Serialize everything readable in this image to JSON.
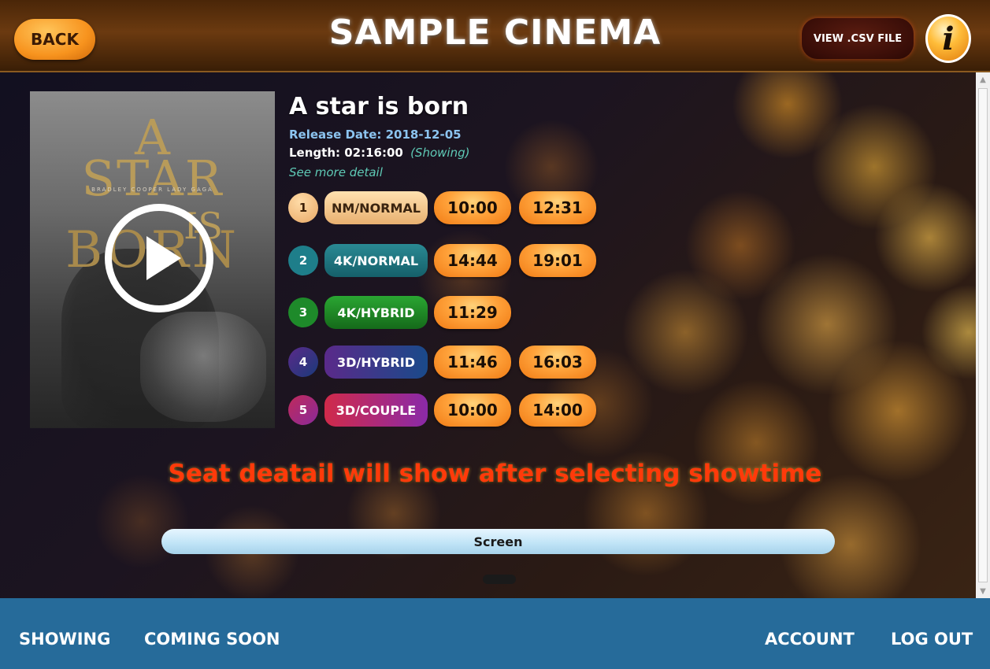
{
  "header": {
    "back_label": "BACK",
    "title": "SAMPLE CINEMA",
    "csv_label": "VIEW .CSV FILE",
    "info_glyph": "i"
  },
  "poster": {
    "text_a": "A",
    "text_star": "STAR",
    "text_is": "IS",
    "text_born": "BORN",
    "text_names": "BRADLEY COOPER   LADY GAGA"
  },
  "movie": {
    "title": "A star is born",
    "release": "Release Date: 2018-12-05",
    "length": "Length: 02:16:00",
    "status": "(Showing)",
    "more_detail": "See more detail"
  },
  "showtimes": [
    {
      "num": "1",
      "type": "NM/NORMAL",
      "times": [
        "10:00",
        "12:31"
      ]
    },
    {
      "num": "2",
      "type": "4K/NORMAL",
      "times": [
        "14:44",
        "19:01"
      ]
    },
    {
      "num": "3",
      "type": "4K/HYBRID",
      "times": [
        "11:29"
      ]
    },
    {
      "num": "4",
      "type": "3D/HYBRID",
      "times": [
        "11:46",
        "16:03"
      ]
    },
    {
      "num": "5",
      "type": "3D/COUPLE",
      "times": [
        "10:00",
        "14:00"
      ]
    }
  ],
  "seat_message": "Seat deatail will show after selecting showtime",
  "screen_label": "Screen",
  "footer": {
    "showing": "SHOWING",
    "coming_soon": "COMING SOON",
    "account": "ACCOUNT",
    "logout": "LOG OUT"
  },
  "colors": {
    "header_bg": "#6b3a10",
    "footer_bg": "#266b9a",
    "time_button": "#ffa23a",
    "seat_message": "#ff3a0a"
  }
}
